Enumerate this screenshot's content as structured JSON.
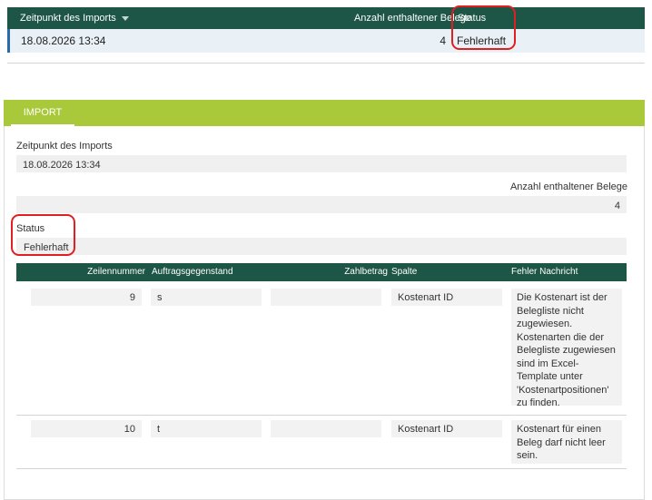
{
  "grid": {
    "headers": {
      "time": "Zeitpunkt des Imports",
      "count": "Anzahl enthaltener Belege",
      "status": "Status"
    },
    "row": {
      "time": "18.08.2026 13:34",
      "count": "4",
      "status": "Fehlerhaft"
    }
  },
  "detail": {
    "tab": "IMPORT",
    "time_label": "Zeitpunkt des Imports",
    "time_value": "18.08.2026 13:34",
    "count_label": "Anzahl enthaltener Belege",
    "count_value": "4",
    "status_label": "Status",
    "status_value": "Fehlerhaft"
  },
  "errors": {
    "headers": {
      "line": "Zeilennummer",
      "subject": "Auftragsgegenstand",
      "amount": "Zahlbetrag",
      "column": "Spalte",
      "message": "Fehler Nachricht"
    },
    "rows": [
      {
        "line": "9",
        "subject": "s",
        "amount": "",
        "column": "Kostenart ID",
        "message": "Die Kostenart ist der Belegliste nicht zugewiesen. Kostenarten die der Belegliste zugewiesen sind im Excel-Template unter 'Kostenartpositionen' zu finden."
      },
      {
        "line": "10",
        "subject": "t",
        "amount": "",
        "column": "Kostenart ID",
        "message": "Kostenart für einen Beleg darf nicht leer sein."
      }
    ]
  }
}
